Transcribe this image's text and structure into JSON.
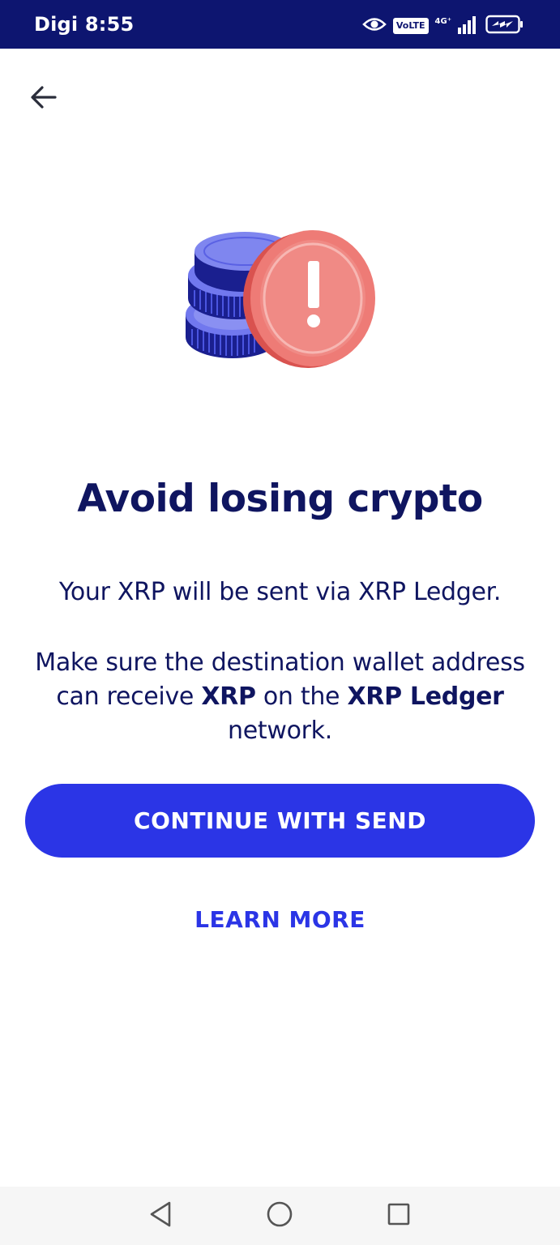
{
  "status_bar": {
    "carrier_time": "Digi 8:55",
    "volte": "VoLTE",
    "network": "4G⁺"
  },
  "icons": {
    "back": "arrow-left-icon",
    "illustration": "coins-warning-icon",
    "nav_back": "triangle-back-icon",
    "nav_home": "circle-home-icon",
    "nav_recents": "square-recents-icon"
  },
  "main": {
    "title": "Avoid losing crypto",
    "line1": "Your XRP will be sent via XRP Ledger.",
    "para2_part1": "Make sure the destination wallet address can receive ",
    "para2_bold1": "XRP",
    "para2_part2": " on the ",
    "para2_bold2": "XRP Ledger",
    "para2_part3": " network."
  },
  "buttons": {
    "continue_label": "CONTINUE WITH SEND",
    "learn_more_label": "LEARN MORE"
  },
  "colors": {
    "status_bar": "#0d1570",
    "primary": "#2b35e6",
    "text": "#0f1560",
    "warning_coin": "#ea6b67"
  }
}
